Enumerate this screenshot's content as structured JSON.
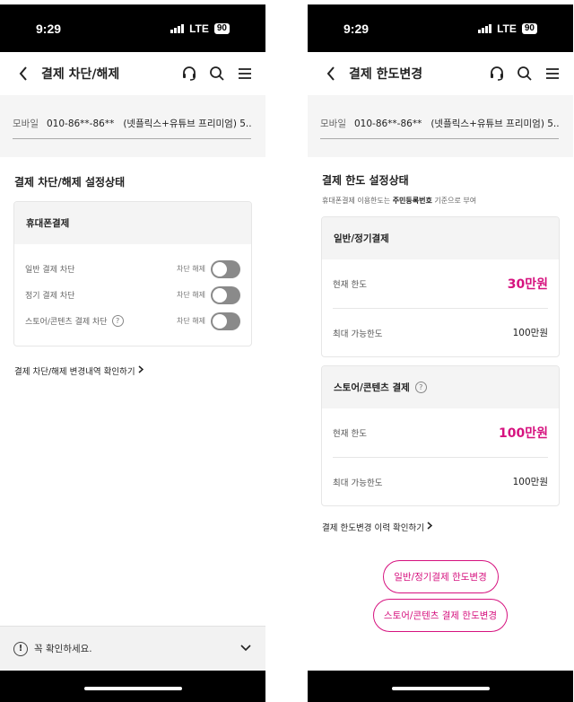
{
  "status_bar": {
    "time": "9:29",
    "network": "LTE",
    "battery": "90"
  },
  "left": {
    "title": "결제 차단/해제",
    "mobile_label": "모바일",
    "mobile_number": "010-86**-86**",
    "plan": "(넷플릭스+유튜브 프리미엄) 5...",
    "section_title": "결제 차단/해제 설정상태",
    "card_title": "휴대폰결제",
    "rows": [
      {
        "label": "일반 결제 차단",
        "state": "차단 해제"
      },
      {
        "label": "정기 결제 차단",
        "state": "차단 해제"
      },
      {
        "label": "스토어/콘텐츠 결제 차단",
        "state": "차단 해제",
        "help": "?"
      }
    ],
    "history_link": "결제 차단/해제 변경내역 확인하기",
    "notice": "꼭 확인하세요."
  },
  "right": {
    "title": "결제 한도변경",
    "mobile_label": "모바일",
    "mobile_number": "010-86**-86**",
    "plan": "(넷플릭스+유튜브 프리미엄) 5...",
    "section_title": "결제 한도 설정상태",
    "subtitle_pre": "휴대폰결제 이용한도는 ",
    "subtitle_bold": "주민등록번호",
    "subtitle_post": " 기준으로 부여",
    "cards": [
      {
        "title": "일반/정기결제",
        "current_label": "현재 한도",
        "current_value": "30만원",
        "max_label": "최대 가능한도",
        "max_value": "100만원"
      },
      {
        "title": "스토어/콘텐츠 결제",
        "help": "?",
        "current_label": "현재 한도",
        "current_value": "100만원",
        "max_label": "최대 가능한도",
        "max_value": "100만원"
      }
    ],
    "history_link": "결제 한도변경 이력 확인하기",
    "buttons": [
      "일반/정기결제 한도변경",
      "스토어/콘텐츠 결제 한도변경"
    ]
  },
  "colors": {
    "accent": "#d6127f",
    "toggle_off": "#8a8a8a",
    "card_header": "#f4f4f4"
  },
  "icons": [
    "back-chevron-icon",
    "headset-icon",
    "search-icon",
    "menu-icon",
    "help-icon",
    "chevron-right-icon",
    "warning-icon",
    "chevron-down-icon"
  ]
}
